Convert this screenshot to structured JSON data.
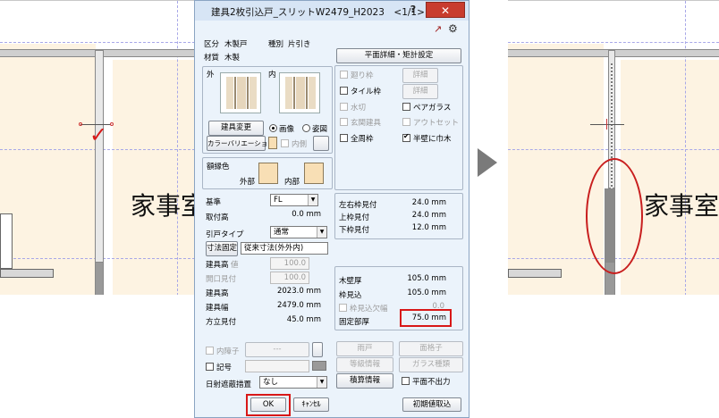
{
  "dialog": {
    "title": "建具2枚引込戸_スリットW2479_H2023　<1/1>",
    "help_label": "?",
    "close_label": "✕",
    "category_label": "区分",
    "category_value": "木製戸",
    "type_label": "種別",
    "type_value": "片引き",
    "material_label": "材質",
    "material_value": "木製",
    "plan_detail_button": "平面詳細・矩計設定",
    "outside_label": "外",
    "inside_label": "内",
    "change_fitting_button": "建具変更",
    "radio_image": "画像",
    "radio_elevation": "姿図",
    "color_variation_button": "カラーバリエーション",
    "inner_side_label": "内側",
    "frame_color_label": "額縁色",
    "exterior_label": "外部",
    "interior_label": "内部",
    "options": {
      "frame_cut": "廻り枠",
      "tile_frame": "タイル枠",
      "water_cut": "水切",
      "entrance_fitting": "玄関建具",
      "all_frames": "全周枠",
      "detail1": "詳細",
      "detail2": "詳細",
      "pair_glass": "ペアガラス",
      "outset": "アウトセット",
      "half_wall_depth": "半壁に巾木"
    },
    "base_label": "基準",
    "base_value": "FL",
    "mount_height_label": "取付高",
    "mount_height_value": "0.0 mm",
    "sliding_type_label": "引戸タイプ",
    "sliding_type_value": "通常",
    "dimension_fix_button": "寸法固定",
    "dimension_fix_value": "従来寸法(外外内)",
    "fitting_height_top_label": "建具高",
    "fitting_height_top_suffix": "値",
    "fitting_height_top_value": "100.0",
    "frame_offset_label": "開口見付",
    "frame_offset_value": "100.0",
    "fitting_height_label": "建具高",
    "fitting_height_value": "2023.0 mm",
    "fitting_width_label": "建具幅",
    "fitting_width_value": "2479.0 mm",
    "stile_label": "方立見付",
    "stile_value": "45.0 mm",
    "lr_frame_label": "左右枠見付",
    "lr_frame_value": "24.0 mm",
    "top_frame_label": "上枠見付",
    "top_frame_value": "24.0 mm",
    "bottom_frame_label": "下枠見付",
    "bottom_frame_value": "12.0 mm",
    "wall_thickness_label": "木壁厚",
    "wall_thickness_value": "105.0 mm",
    "frame_depth_label": "枠見込",
    "frame_depth_value": "105.0 mm",
    "frame_depth_gap_label": "枠見込欠幅",
    "frame_depth_gap_value": "0.0",
    "fixed_thickness_label": "固定部厚",
    "fixed_thickness_value": "75.0 mm",
    "mullion_label": "内障子",
    "mullion_value": "---",
    "symbol_label": "記号",
    "shading_label": "日射遮蔽措置",
    "shading_value": "なし",
    "storm_shutter_button": "雨戸",
    "lattice_button": "面格子",
    "fitting_info_button": "等級情報",
    "glass_type_button": "ガラス種類",
    "estimate_info_button": "積算情報",
    "no_plan_output_label": "平面不出力",
    "ok_button": "OK",
    "cancel_button": "ｷｬﾝｾﾙ",
    "reset_button": "初期値取込"
  },
  "cad": {
    "room_text_left": "家事室",
    "room_text_right": "家事室"
  },
  "colors": {
    "highlight_red": "#d81818",
    "checkmark_red": "#d81818",
    "swatch": "#f8dfb5",
    "arrow": "#7a7a7a"
  }
}
